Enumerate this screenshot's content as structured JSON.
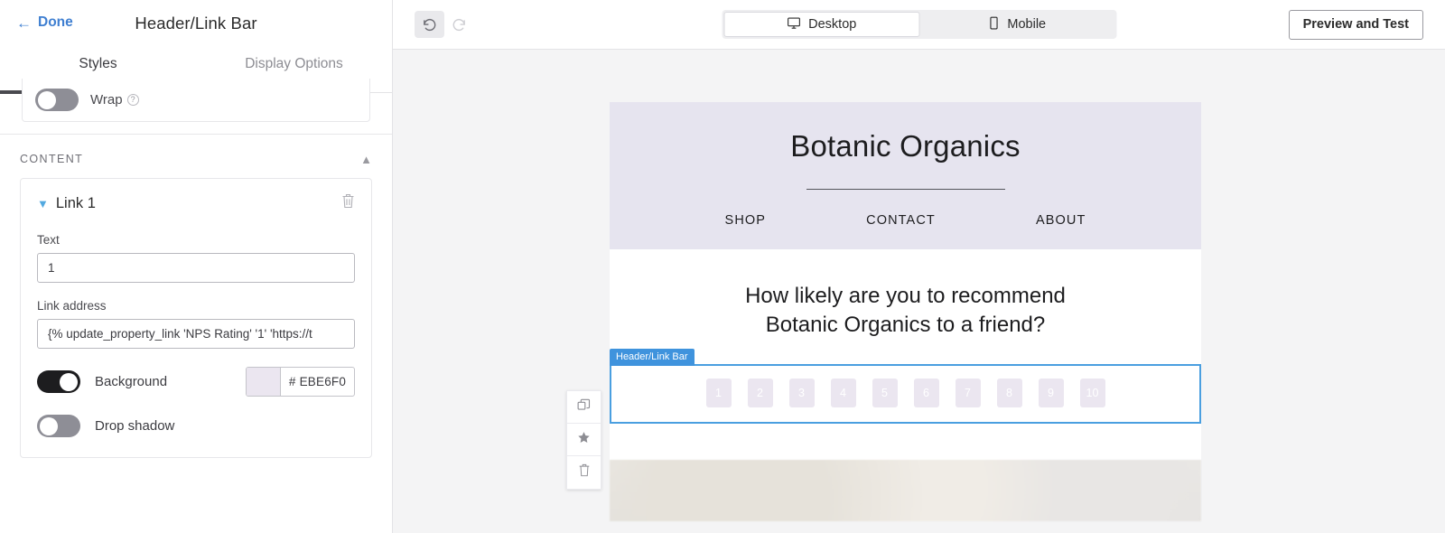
{
  "sidebar": {
    "done_label": "Done",
    "title": "Header/Link Bar",
    "tabs": [
      {
        "label": "Styles",
        "active": true
      },
      {
        "label": "Display Options",
        "active": false
      }
    ],
    "wrap": {
      "label": "Wrap",
      "info": "?",
      "state": "off"
    },
    "content_section": {
      "title": "CONTENT",
      "collapse_icon": "chevron-up-icon"
    },
    "link_card": {
      "title": "Link 1",
      "caret_icon": "chevron-down-icon",
      "delete_icon": "trash-icon",
      "text_field": {
        "label": "Text",
        "value": "1"
      },
      "link_address_field": {
        "label": "Link address",
        "value": "{% update_property_link 'NPS Rating' '1' 'https://t"
      },
      "background_toggle": {
        "label": "Background",
        "state": "on"
      },
      "background_color": {
        "hex": "# EBE6F0",
        "value": "#EBE6F0"
      },
      "drop_shadow_toggle": {
        "label": "Drop shadow",
        "state": "off"
      }
    }
  },
  "topbar": {
    "undo_icon": "undo-icon",
    "redo_icon": "redo-icon",
    "devices": [
      {
        "label": "Desktop",
        "icon": "monitor-icon",
        "active": true
      },
      {
        "label": "Mobile",
        "icon": "phone-icon",
        "active": false
      }
    ],
    "preview_label": "Preview and Test"
  },
  "email": {
    "brand": "Botanic Organics",
    "nav": [
      "SHOP",
      "CONTACT",
      "ABOUT"
    ],
    "question_line1": "How likely are you to recommend",
    "question_line2": "Botanic Organics to a friend?",
    "selection_tag": "Header/Link Bar",
    "ratings": [
      "1",
      "2",
      "3",
      "4",
      "5",
      "6",
      "7",
      "8",
      "9",
      "10"
    ]
  },
  "float_tools": [
    {
      "name": "duplicate-icon"
    },
    {
      "name": "star-icon"
    },
    {
      "name": "trash-icon"
    }
  ],
  "colors": {
    "accent_blue": "#3f7fd1",
    "selection_blue": "#4a9fe0",
    "header_bg": "#e6e4ef",
    "rating_bg": "#EBE6F0",
    "canvas_bg": "#f4f4f5"
  }
}
